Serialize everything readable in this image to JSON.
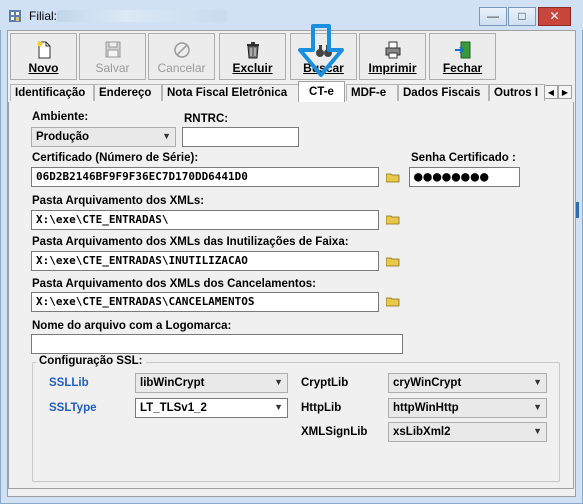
{
  "window": {
    "title_prefix": "Filial:",
    "controls": {
      "minimize": "—",
      "maximize": "□",
      "close": "✕"
    }
  },
  "toolbar": {
    "buttons": [
      {
        "key": "novo",
        "label": "Novo",
        "icon": "new-document-icon",
        "enabled": true
      },
      {
        "key": "salvar",
        "label": "Salvar",
        "icon": "floppy-disk-icon",
        "enabled": false
      },
      {
        "key": "cancelar",
        "label": "Cancelar",
        "icon": "cancel-circle-icon",
        "enabled": false
      },
      {
        "key": "excluir",
        "label": "Excluir",
        "icon": "trash-can-icon",
        "enabled": true
      },
      {
        "key": "buscar",
        "label": "Buscar",
        "icon": "binoculars-icon",
        "enabled": true
      },
      {
        "key": "imprimir",
        "label": "Imprimir",
        "icon": "printer-icon",
        "enabled": true
      },
      {
        "key": "fechar",
        "label": "Fechar",
        "icon": "exit-door-icon",
        "enabled": true
      }
    ]
  },
  "tabs": {
    "items": [
      "Identificação",
      "Endereço",
      "Nota Fiscal Eletrônica",
      "CT-e",
      "MDF-e",
      "Dados Fiscais",
      "Outros I"
    ],
    "active": "CT-e"
  },
  "form": {
    "ambiente_label": "Ambiente:",
    "ambiente_value": "Produção",
    "rntrc_label": "RNTRC:",
    "rntrc_value": "",
    "certificado_label": "Certificado (Número de Série):",
    "certificado_value": "06D2B2146BF9F9F36EC7D170DD6441D0",
    "senha_label": "Senha Certificado :",
    "senha_value": "●●●●●●●●",
    "pasta_xml_label": "Pasta Arquivamento dos XMLs:",
    "pasta_xml_value": "X:\\exe\\CTE_ENTRADAS\\",
    "pasta_inut_label": "Pasta Arquivamento dos XMLs das Inutilizações de Faixa:",
    "pasta_inut_value": "X:\\exe\\CTE_ENTRADAS\\INUTILIZACAO",
    "pasta_canc_label": "Pasta Arquivamento dos XMLs dos Cancelamentos:",
    "pasta_canc_value": "X:\\exe\\CTE_ENTRADAS\\CANCELAMENTOS",
    "logomarca_label": "Nome do arquivo com a Logomarca:",
    "logomarca_value": ""
  },
  "ssl": {
    "group_label": "Configuração SSL:",
    "ssllib_label": "SSLLib",
    "ssllib_value": "libWinCrypt",
    "ssltype_label": "SSLType",
    "ssltype_value": "LT_TLSv1_2",
    "cryptlib_label": "CryptLib",
    "cryptlib_value": "cryWinCrypt",
    "httplib_label": "HttpLib",
    "httplib_value": "httpWinHttp",
    "xmlsignlib_label": "XMLSignLib",
    "xmlsignlib_value": "xsLibXml2"
  },
  "colors": {
    "accent_arrow": "#1a8fe0",
    "ssl_label_blue": "#1e5fbf",
    "close_red": "#c9463d"
  }
}
